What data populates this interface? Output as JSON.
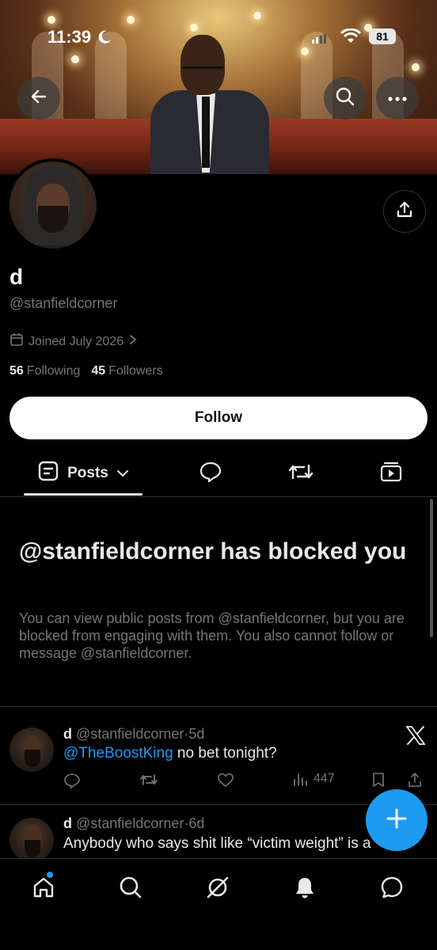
{
  "status_bar": {
    "time": "11:39",
    "battery": "81"
  },
  "profile": {
    "name": "d",
    "handle": "@stanfieldcorner",
    "joined": "Joined July 2026",
    "following_count": "56",
    "following_label": "Following",
    "followers_count": "45",
    "followers_label": "Followers",
    "follow_button": "Follow"
  },
  "tabs": {
    "posts_label": "Posts"
  },
  "blocked": {
    "title": "@stanfieldcorner has blocked you",
    "description": "You can view public posts from @stanfieldcorner, but you are blocked from engaging with them. You also cannot follow or message @stanfieldcorner."
  },
  "posts": [
    {
      "name": "d",
      "handle": "@stanfieldcorner",
      "sep": "·",
      "time": "5d",
      "mention": "@TheBoostKing",
      "text": " no bet tonight?",
      "views": "447"
    },
    {
      "name": "d",
      "handle": "@stanfieldcorner",
      "sep": "·",
      "time": "6d",
      "text": "Anybody who says shit like “victim weight” is a"
    }
  ],
  "colors": {
    "accent": "#1d9bf0",
    "muted": "#71767b",
    "divider": "#2f3336"
  },
  "icons": [
    "back-arrow-icon",
    "search-icon",
    "more-icon",
    "share-icon",
    "calendar-icon",
    "chevron-right-icon",
    "posts-icon",
    "chevron-down-icon",
    "reply-icon",
    "repost-icon",
    "media-icon",
    "x-logo-icon",
    "compose-plus-icon",
    "home-icon",
    "grok-icon",
    "bell-icon",
    "message-icon"
  ]
}
